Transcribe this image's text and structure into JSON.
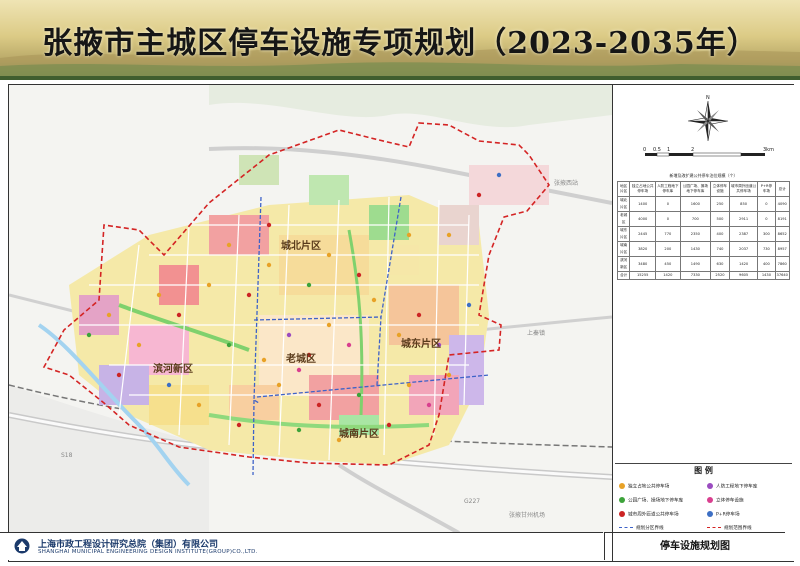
{
  "title": "张掖市主城区停车设施专项规划（2023-2035年）",
  "map_title": "停车设施规划图",
  "company": {
    "name_cn": "上海市政工程设计研究总院（集团）有限公司",
    "name_en": "SHANGHAI MUNICIPAL ENGINEERING DESIGN INSTITUTE(GROUP)CO.,LTD."
  },
  "districts": {
    "north": "城北片区",
    "east": "城东片区",
    "old": "老城区",
    "south": "城南片区",
    "binhe": "滨河新区"
  },
  "place_labels": {
    "shangqin": "上秦镇",
    "station": "张掖西站",
    "airport": "张掖甘州机场",
    "road_s18": "S18",
    "road_g227": "G227"
  },
  "scale": {
    "ticks": [
      "0",
      "0.5",
      "1",
      "2",
      "3km"
    ]
  },
  "compass": {
    "north_label": "N"
  },
  "capacity_table": {
    "title": "新增及改扩建公共停车泊位规模（个）",
    "headers": [
      "地区片区",
      "独立占地公共停车场",
      "人防工程地下停车库",
      "公园广场、操场地下停车库",
      "立体停车设施",
      "城市周外匝道公共停车场",
      "P+R停车场",
      "总计"
    ],
    "rows": [
      [
        "城北片区",
        "1400",
        "0",
        "1600",
        "250",
        "850",
        "0",
        "4090"
      ],
      [
        "老城区",
        "4000",
        "0",
        "700",
        "500",
        "2911",
        "0",
        "8191"
      ],
      [
        "城东片区",
        "2445",
        "770",
        "2350",
        "400",
        "2387",
        "300",
        "8652"
      ],
      [
        "城南片区",
        "3820",
        "200",
        "1430",
        "740",
        "2037",
        "730",
        "8957"
      ],
      [
        "滨河新区",
        "3480",
        "450",
        "1490",
        "630",
        "1420",
        "400",
        "7860"
      ],
      [
        "合计",
        "15255",
        "1420",
        "7330",
        "2520",
        "9605",
        "1430",
        "37640"
      ]
    ]
  },
  "legend": {
    "title": "图 例",
    "items": [
      {
        "label": "独立占地公共停车场",
        "color": "#e8a227"
      },
      {
        "label": "人防工程地下停车库",
        "color": "#9b4cc0"
      },
      {
        "label": "公园广场、操场地下停车库",
        "color": "#3da33a"
      },
      {
        "label": "立体停车设施",
        "color": "#d93f8f"
      },
      {
        "label": "城市周外匝道公共停车场",
        "color": "#cc2424"
      },
      {
        "label": "P+R停车场",
        "color": "#3d6fc4"
      },
      {
        "label": "规划分区界线",
        "color": "#3e62c8"
      },
      {
        "label": "规划范围界线",
        "color": "#d42424"
      }
    ]
  }
}
